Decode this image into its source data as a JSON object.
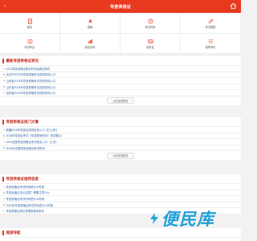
{
  "header": {
    "title": "导游资格证",
    "back_glyph": "‹"
  },
  "nav": {
    "items": [
      {
        "label": "报名",
        "icon": "document-icon"
      },
      {
        "label": "指南",
        "icon": "guide-icon"
      },
      {
        "label": "考试时间",
        "icon": "clock-icon"
      },
      {
        "label": "考试题型",
        "icon": "pencil-icon"
      },
      {
        "label": "考试科目",
        "icon": "book-icon"
      },
      {
        "label": "成绩查询",
        "icon": "chart-icon"
      },
      {
        "label": "准考证",
        "icon": "card-icon"
      },
      {
        "label": "报考条件",
        "icon": "list-icon"
      }
    ]
  },
  "sections": [
    {
      "title": "最新导游资格证资讯",
      "items": [
        "2023导游资格证报名时间及报名条件",
        "北京市2023年导游资格考试成绩查询入口",
        "山西省2023年导游资格考试成绩查询入口",
        "山东省2023年导游资格考试成绩查询入口",
        "吉林省2023年导游资格考试成绩查询入口"
      ],
      "more": "点击加载更多"
    },
    {
      "title": "导游资格证热门文章",
      "items": [
        "新疆2018年导游证成绩查询入口【已公布】",
        "2018年导游证考试《导游基础知识》测试题(1)",
        "2020全国导游资格证考试报名入口（汇总）",
        "2019年全国导游资格证考试时间"
      ],
      "more": "点击加载更多"
    },
    {
      "title": "导游资格证推荐信息",
      "items": [
        "导游资格证考试时间是什么时候",
        "导游证通过怎么挂靠？需要注意什么",
        "导游资格证考试时间是什么时候",
        "2022年导游资格证考试时间是什么时候",
        "导游资格证报名有哪些报考条件"
      ]
    },
    {
      "title": "底部导航"
    }
  ],
  "watermark": {
    "text": "便民库"
  },
  "colors": {
    "brand": "#e8391f",
    "link": "#3366aa"
  }
}
